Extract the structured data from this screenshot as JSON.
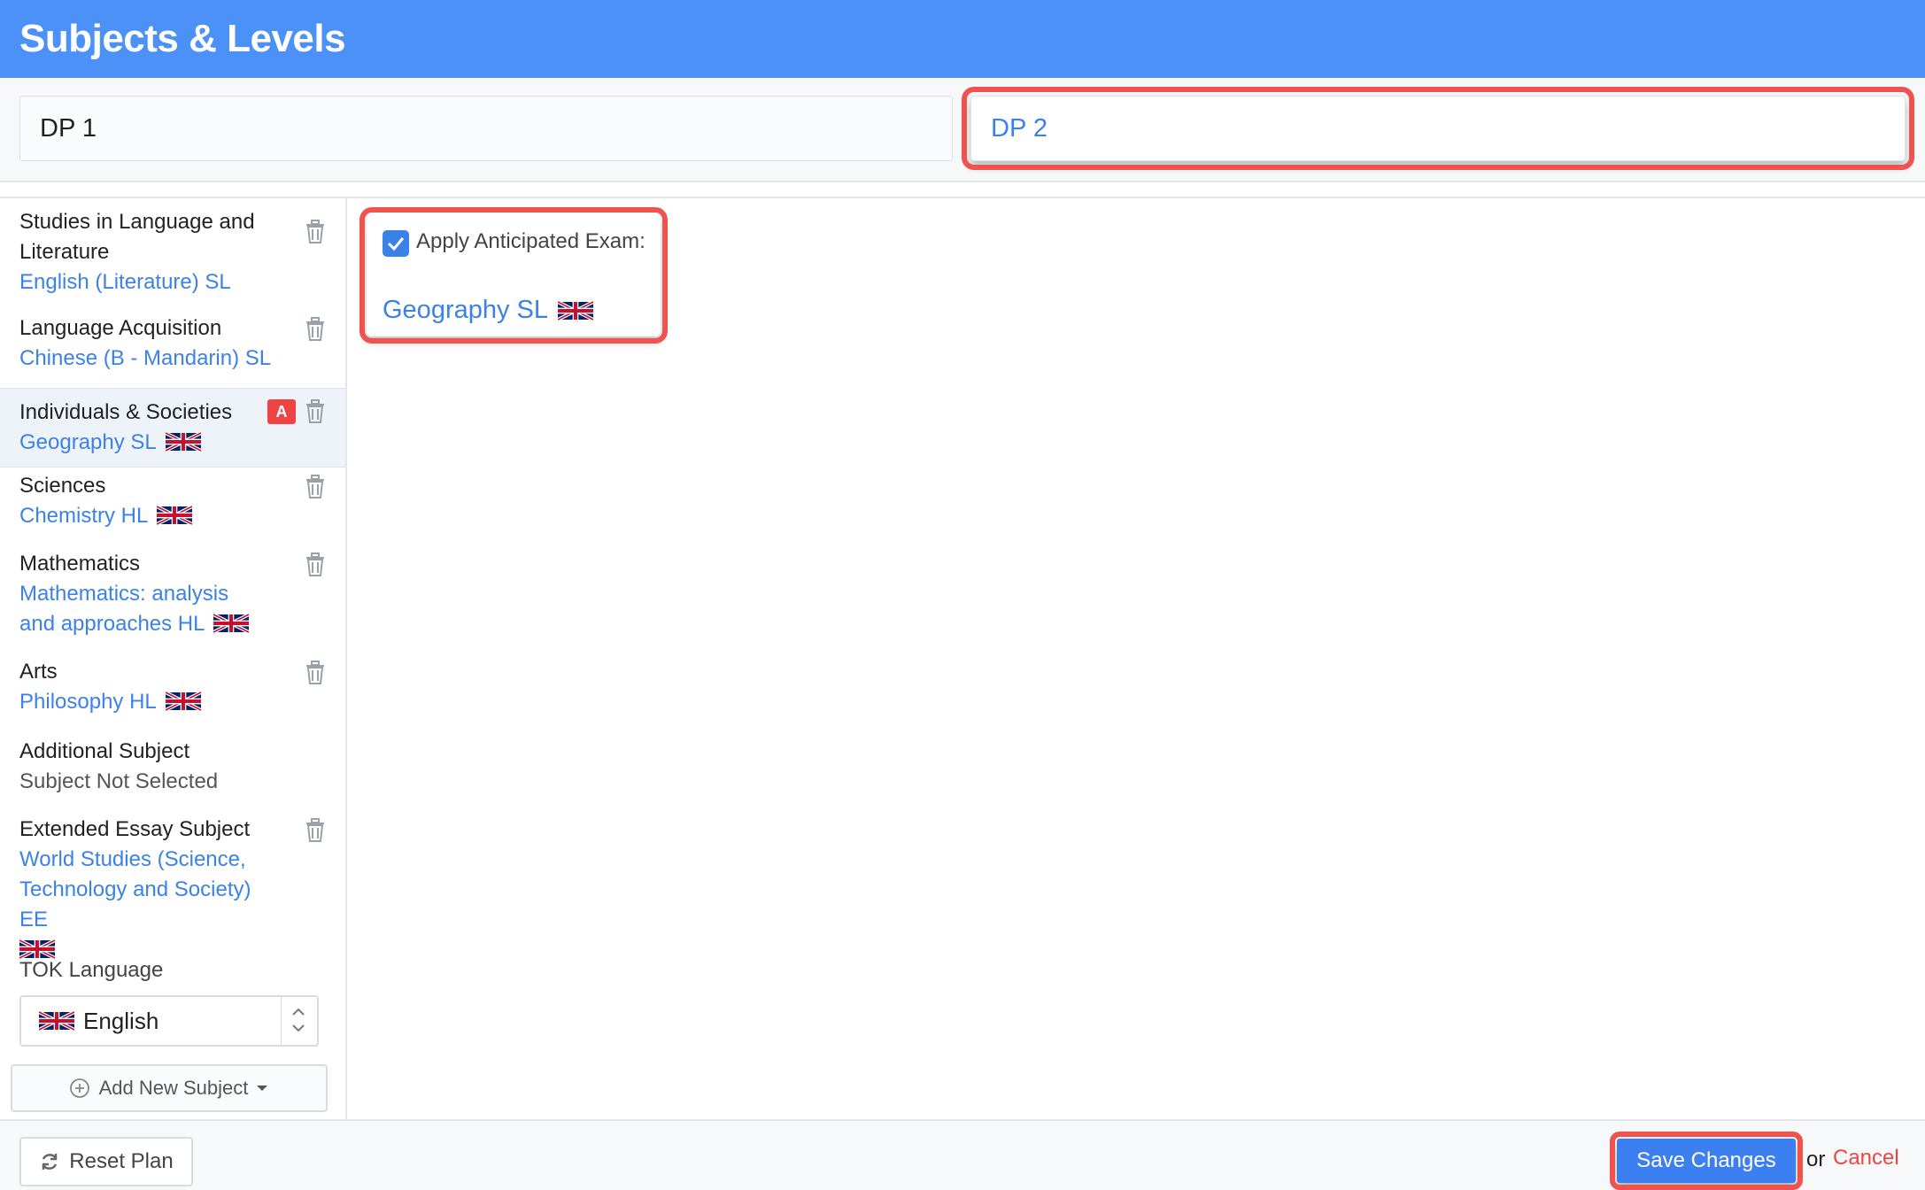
{
  "header": {
    "title": "Subjects & Levels"
  },
  "tabs": [
    {
      "label": "DP 1"
    },
    {
      "label": "DP 2"
    }
  ],
  "subjects": [
    {
      "category": "Studies in Language and Literature",
      "selection": "English (Literature) SL",
      "flag": false
    },
    {
      "category": "Language Acquisition",
      "selection": "Chinese (B - Mandarin) SL",
      "flag": false
    },
    {
      "category": "Individuals & Societies",
      "selection": "Geography SL",
      "flag": true,
      "badge": "A"
    },
    {
      "category": "Sciences",
      "selection": "Chemistry HL",
      "flag": true
    },
    {
      "category": "Mathematics",
      "selection": "Mathematics: analysis and approaches HL",
      "flag": true
    },
    {
      "category": "Arts",
      "selection": "Philosophy HL",
      "flag": true
    },
    {
      "category": "Additional Subject",
      "selection": "Subject Not Selected",
      "flag": false
    },
    {
      "category": "Extended Essay Subject",
      "selection": "World Studies (Science, Technology and Society) EE",
      "flag": true
    }
  ],
  "tok": {
    "label": "TOK Language",
    "value": "English"
  },
  "add_subject": {
    "label": "Add New Subject"
  },
  "exam": {
    "checkbox_label": "Apply Anticipated Exam:",
    "checked": true,
    "subject": "Geography SL"
  },
  "footer": {
    "reset_label": "Reset Plan",
    "save_label": "Save Changes",
    "or_text": "or",
    "cancel_label": "Cancel"
  },
  "colors": {
    "header": "#4c91f8",
    "link": "#3b82e8",
    "highlight": "#ef5350",
    "badge": "#ef4444"
  },
  "icons": {
    "trash": "trash-icon",
    "flag": "uk-flag-icon",
    "refresh": "refresh-icon",
    "plus": "plus-circle-icon",
    "caret": "caret-down-icon",
    "check": "check-icon"
  }
}
